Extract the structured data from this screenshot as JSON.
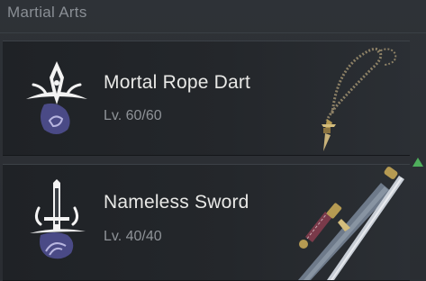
{
  "section": {
    "title": "Martial Arts"
  },
  "items": [
    {
      "name": "Mortal Rope Dart",
      "level": "Lv. 60/60",
      "emblem_icon": "rope-dart-emblem-icon",
      "art_icon": "rope-dart-weapon-icon"
    },
    {
      "name": "Nameless Sword",
      "level": "Lv. 40/40",
      "emblem_icon": "sword-emblem-icon",
      "art_icon": "sword-weapon-icon"
    }
  ],
  "colors": {
    "background": "#2a2e33",
    "card": "#1f2226",
    "name_text": "#e8e8e6",
    "level_text": "#8f9398",
    "accent_purple": "#4a4a86",
    "accent_gold": "#b59a52",
    "scroll_indicator": "#4fae5c"
  }
}
